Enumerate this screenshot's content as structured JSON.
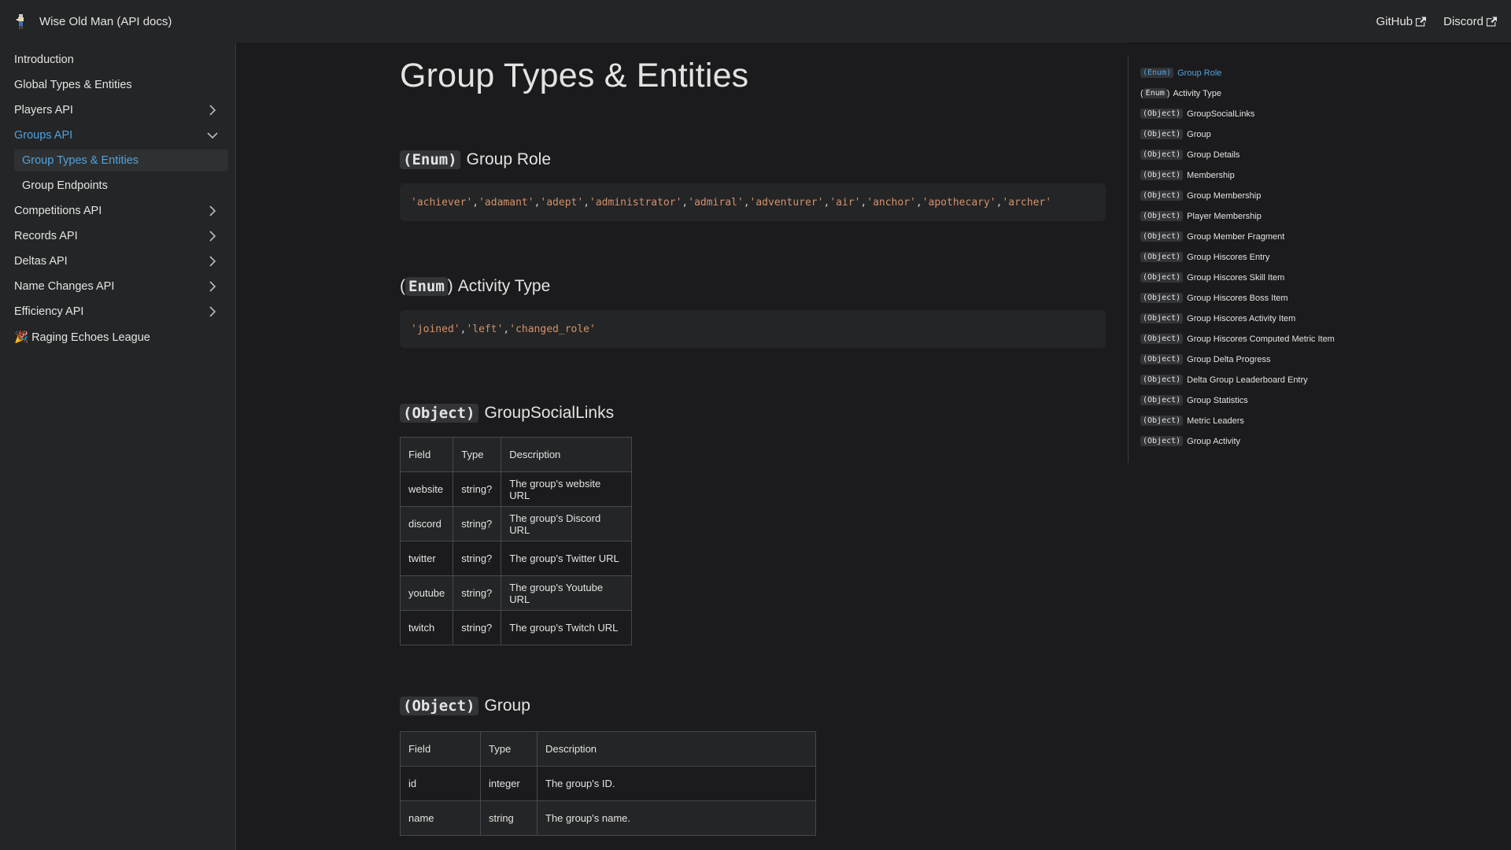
{
  "navbar": {
    "brand_title": "Wise Old Man (API docs)",
    "links": [
      {
        "label": "GitHub"
      },
      {
        "label": "Discord"
      }
    ]
  },
  "sidebar": {
    "items": [
      {
        "label": "Introduction"
      },
      {
        "label": "Global Types & Entities"
      },
      {
        "label": "Players API"
      },
      {
        "label": "Groups API"
      },
      {
        "label": "Competitions API"
      },
      {
        "label": "Records API"
      },
      {
        "label": "Deltas API"
      },
      {
        "label": "Name Changes API"
      },
      {
        "label": "Efficiency API"
      },
      {
        "label": "🎉 Raging Echoes League"
      }
    ],
    "groups_sub": [
      {
        "label": "Group Types & Entities"
      },
      {
        "label": "Group Endpoints"
      }
    ]
  },
  "main": {
    "title": "Group Types & Entities",
    "sections": {
      "group_role": {
        "tag": "(Enum)",
        "title": "Group Role",
        "code": [
          "'achiever'",
          "'adamant'",
          "'adept'",
          "'administrator'",
          "'admiral'",
          "'adventurer'",
          "'air'",
          "'anchor'",
          "'apothecary'",
          "'archer'"
        ]
      },
      "activity_type": {
        "paren_open": "(",
        "tag": "Enum",
        "paren_close": ")",
        "title": "Activity Type",
        "code": [
          "'joined'",
          "'left'",
          "'changed_role'"
        ]
      },
      "social_links": {
        "tag": "(Object)",
        "title": "GroupSocialLinks",
        "headers": [
          "Field",
          "Type",
          "Description"
        ],
        "rows": [
          [
            "website",
            "string?",
            "The group's website URL"
          ],
          [
            "discord",
            "string?",
            "The group's Discord URL"
          ],
          [
            "twitter",
            "string?",
            "The group's Twitter URL"
          ],
          [
            "youtube",
            "string?",
            "The group's Youtube URL"
          ],
          [
            "twitch",
            "string?",
            "The group's Twitch URL"
          ]
        ]
      },
      "group": {
        "tag": "(Object)",
        "title": "Group",
        "headers": [
          "Field",
          "Type",
          "Description"
        ],
        "rows": [
          [
            "id",
            "integer",
            "The group's ID."
          ],
          [
            "name",
            "string",
            "The group's name."
          ]
        ]
      }
    }
  },
  "toc": {
    "items": [
      {
        "tag": "(Enum)",
        "label": "Group Role"
      },
      {
        "tag": "Enum",
        "label": "Activity Type"
      },
      {
        "tag": "(Object)",
        "label": "GroupSocialLinks"
      },
      {
        "tag": "(Object)",
        "label": "Group"
      },
      {
        "tag": "(Object)",
        "label": "Group Details"
      },
      {
        "tag": "(Object)",
        "label": "Membership"
      },
      {
        "tag": "(Object)",
        "label": "Group Membership"
      },
      {
        "tag": "(Object)",
        "label": "Player Membership"
      },
      {
        "tag": "(Object)",
        "label": "Group Member Fragment"
      },
      {
        "tag": "(Object)",
        "label": "Group Hiscores Entry"
      },
      {
        "tag": "(Object)",
        "label": "Group Hiscores Skill Item"
      },
      {
        "tag": "(Object)",
        "label": "Group Hiscores Boss Item"
      },
      {
        "tag": "(Object)",
        "label": "Group Hiscores Activity Item"
      },
      {
        "tag": "(Object)",
        "label": "Group Hiscores Computed Metric Item"
      },
      {
        "tag": "(Object)",
        "label": "Group Delta Progress"
      },
      {
        "tag": "(Object)",
        "label": "Delta Group Leaderboard Entry"
      },
      {
        "tag": "(Object)",
        "label": "Group Statistics"
      },
      {
        "tag": "(Object)",
        "label": "Metric Leaders"
      },
      {
        "tag": "(Object)",
        "label": "Group Activity"
      }
    ]
  },
  "colors": {
    "accent": "#4fa3e0",
    "string_literal": "#d6916b",
    "background": "#1b1b1d",
    "surface": "#242526"
  },
  "icons": [
    "wise-old-man-logo-icon",
    "external-link-icon",
    "chevron-right-icon",
    "chevron-down-icon"
  ]
}
